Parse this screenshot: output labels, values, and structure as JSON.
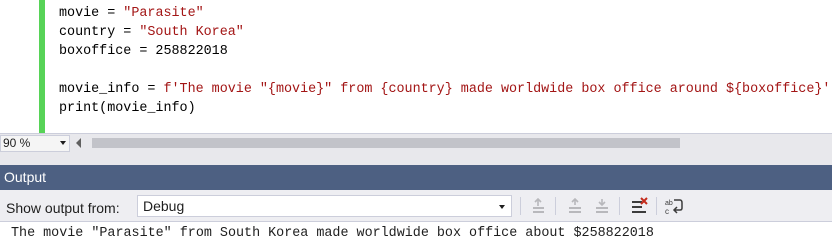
{
  "editor": {
    "lines": [
      {
        "segments": [
          {
            "text": "movie = ",
            "kind": "plain"
          },
          {
            "text": "\"Parasite\"",
            "kind": "str"
          }
        ]
      },
      {
        "segments": [
          {
            "text": "country = ",
            "kind": "plain"
          },
          {
            "text": "\"South Korea\"",
            "kind": "str"
          }
        ]
      },
      {
        "segments": [
          {
            "text": "boxoffice = 258822018",
            "kind": "plain"
          }
        ]
      },
      {
        "segments": [
          {
            "text": "",
            "kind": "plain"
          }
        ]
      },
      {
        "segments": [
          {
            "text": "movie_info = ",
            "kind": "plain"
          },
          {
            "text": "f'The movie \"{movie}\" from {country} made worldwide box office around ${boxoffice}'",
            "kind": "str"
          }
        ]
      },
      {
        "segments": [
          {
            "text": "print(movie_info)",
            "kind": "plain"
          }
        ]
      }
    ]
  },
  "zoom": {
    "value": "90 %"
  },
  "output": {
    "title": "Output",
    "show_from_label": "Show output from:",
    "source_value": "Debug",
    "text": "The movie \"Parasite\" from South Korea made worldwide box office about $258822018"
  },
  "toolbar_icons": [
    "go-to-previous-message-icon",
    "find-message-in-code-icon",
    "go-to-previous-icon",
    "go-to-next-icon",
    "clear-all-icon",
    "toggle-word-wrap-icon"
  ],
  "colors": {
    "string": "#a31515",
    "change_bar": "#57d357",
    "panel_title_bg": "#4d6082"
  }
}
